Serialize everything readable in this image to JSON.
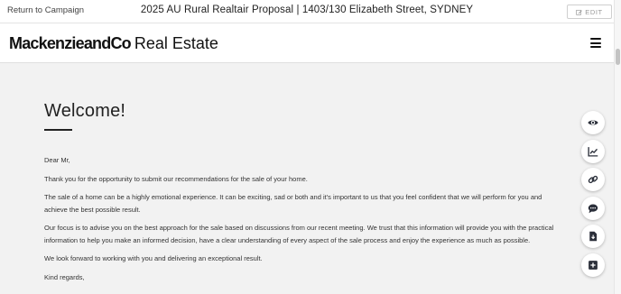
{
  "topbar": {
    "return_label": "Return to Campaign",
    "title": "2025 AU Rural Realtair Proposal  |  1403/130 Elizabeth Street, SYDNEY",
    "edit_label": "EDIT"
  },
  "header": {
    "logo_bold": "MackenzieandCo",
    "logo_light": "Real Estate",
    "menu_icon": "hamburger-menu-icon"
  },
  "main": {
    "heading": "Welcome!",
    "salutation": "Dear Mr,",
    "paragraphs": [
      "Thank you for the opportunity to submit our recommendations for the sale of your home.",
      "The sale of a home can be a highly emotional experience. It can be exciting, sad or both and it's important to us that you feel confident that we will perform for you and achieve the best possible result.",
      "Our focus is to advise you on the best approach for the sale based on discussions from our recent meeting. We trust that this information will provide you with the practical information to help you make an informed decision, have a clear understanding of every aspect of the sale process and enjoy the experience as much as possible.",
      "We look forward to working with you and delivering an exceptional result."
    ],
    "closing": "Kind regards,"
  },
  "actions": [
    {
      "icon": "eye-icon"
    },
    {
      "icon": "chart-line-icon"
    },
    {
      "icon": "link-icon"
    },
    {
      "icon": "comment-icon"
    },
    {
      "icon": "file-download-icon"
    },
    {
      "icon": "plus-square-icon"
    }
  ],
  "colors": {
    "accent": "#222222",
    "background": "#f2f2f2"
  }
}
